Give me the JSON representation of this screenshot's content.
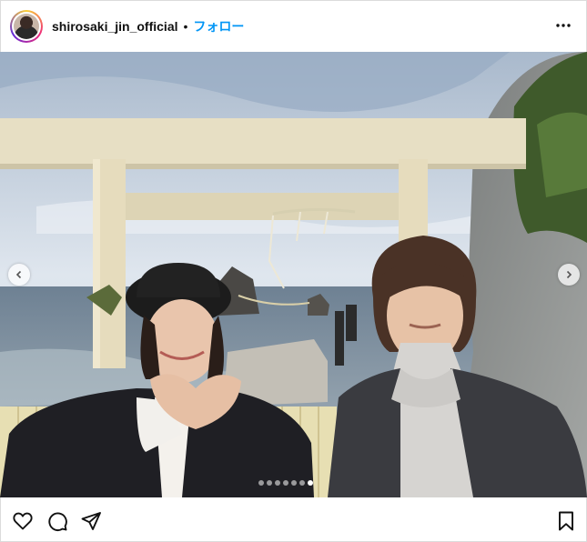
{
  "post": {
    "username": "shirosaki_jin_official",
    "separator": "•",
    "follow_label": "フォロー"
  },
  "carousel": {
    "slide_count": 7,
    "active_index": 6
  },
  "icons": {
    "more": "more-horizontal-icon",
    "like": "heart-icon",
    "comment": "comment-icon",
    "share": "send-icon",
    "save": "bookmark-icon",
    "prev": "chevron-left-icon",
    "next": "chevron-right-icon"
  }
}
